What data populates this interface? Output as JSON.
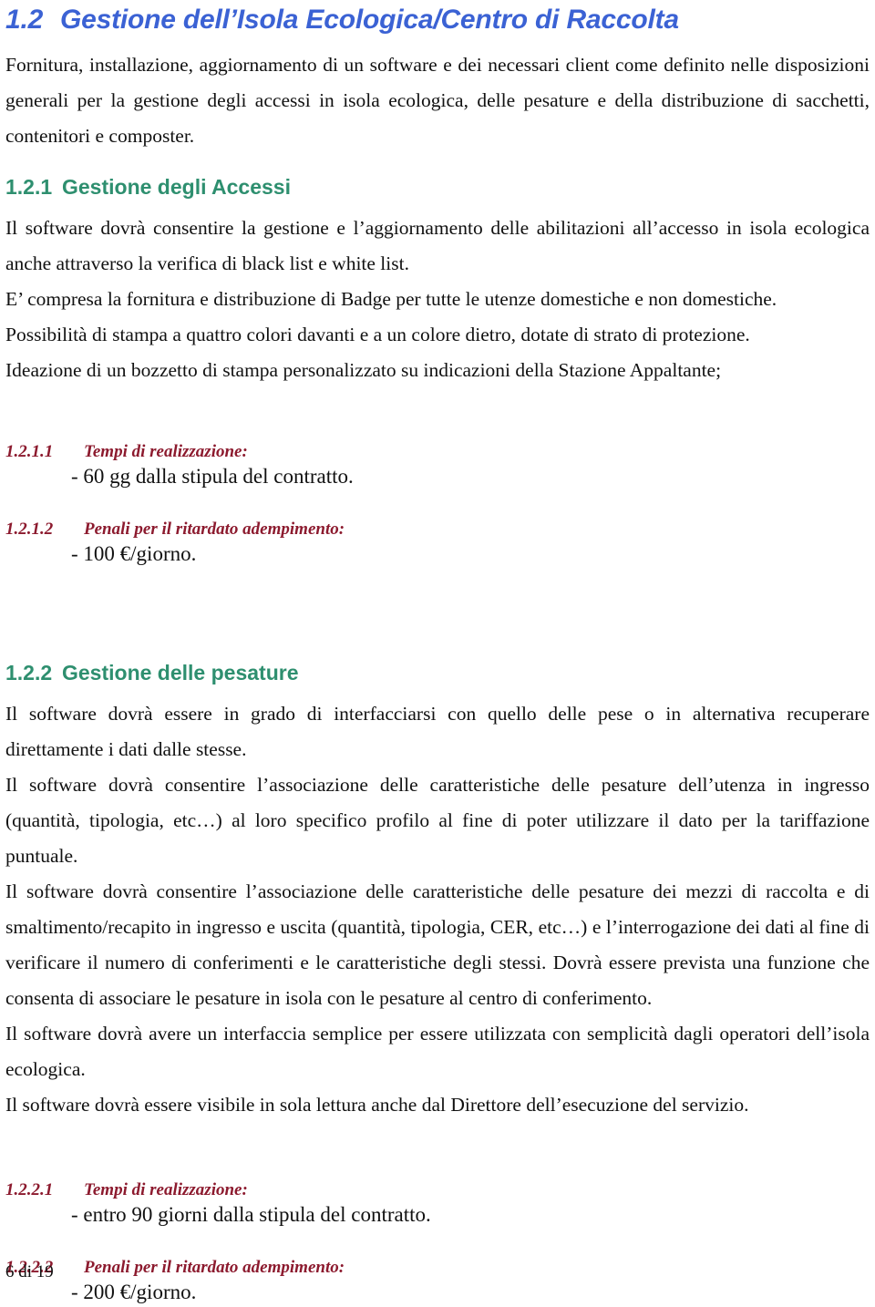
{
  "document": {
    "footer": "6 di 19"
  },
  "colors": {
    "heading_level2": "#3B62D4",
    "heading_level3": "#2E8F6F",
    "heading_level4": "#8C1A2E",
    "body_text": "#111111",
    "page_background": "#FFFFFF"
  },
  "sections": {
    "s1_2": {
      "number": "1.2",
      "title": "Gestione dell’Isola Ecologica/Centro di Raccolta",
      "intro": "Fornitura, installazione, aggiornamento di un software e dei necessari client come definito nelle disposizioni generali per la gestione degli accessi in isola ecologica, delle pesature e della distribuzione di sacchetti, contenitori e composter."
    },
    "s1_2_1": {
      "number": "1.2.1",
      "title": "Gestione degli Accessi",
      "paragraphs": [
        "Il software dovrà consentire la gestione e l’aggiornamento delle abilitazioni all’accesso in isola ecologica anche attraverso la verifica di black list e white list.",
        "E’ compresa la fornitura e distribuzione di Badge per tutte le utenze domestiche e non domestiche.",
        "Possibilità di stampa a quattro colori davanti e a un colore dietro, dotate di strato di protezione.",
        "Ideazione di un bozzetto di stampa personalizzato su indicazioni della Stazione Appaltante;"
      ]
    },
    "s1_2_1_1": {
      "number": "1.2.1.1",
      "title": "Tempi di realizzazione:",
      "value": "- 60 gg dalla stipula del contratto."
    },
    "s1_2_1_2": {
      "number": "1.2.1.2",
      "title": "Penali per il ritardato adempimento:",
      "value": "- 100 €/giorno."
    },
    "s1_2_2": {
      "number": "1.2.2",
      "title": "Gestione delle pesature",
      "paragraphs": [
        "Il software dovrà essere in grado di interfacciarsi con quello delle pese o in alternativa recuperare direttamente i dati dalle stesse.",
        "Il software dovrà consentire l’associazione delle caratteristiche delle pesature dell’utenza in ingresso (quantità, tipologia, etc…) al loro specifico profilo al fine di poter utilizzare il dato per la tariffazione puntuale.",
        "Il software dovrà consentire l’associazione delle caratteristiche delle pesature dei mezzi di raccolta e di smaltimento/recapito in ingresso e uscita (quantità, tipologia, CER, etc…) e l’interrogazione dei dati al fine di verificare il numero di conferimenti e le caratteristiche degli stessi. Dovrà essere prevista una funzione che consenta di associare le pesature in isola con le pesature al centro di conferimento.",
        "Il software dovrà avere un interfaccia semplice per essere utilizzata con semplicità dagli operatori dell’isola ecologica.",
        "Il software dovrà essere visibile in sola lettura anche dal Direttore dell’esecuzione del servizio."
      ]
    },
    "s1_2_2_1": {
      "number": "1.2.2.1",
      "title": "Tempi di realizzazione:",
      "value": "- entro 90 giorni dalla stipula del contratto."
    },
    "s1_2_2_2": {
      "number": "1.2.2.2",
      "title": "Penali per il ritardato adempimento:",
      "value": "- 200 €/giorno."
    }
  }
}
